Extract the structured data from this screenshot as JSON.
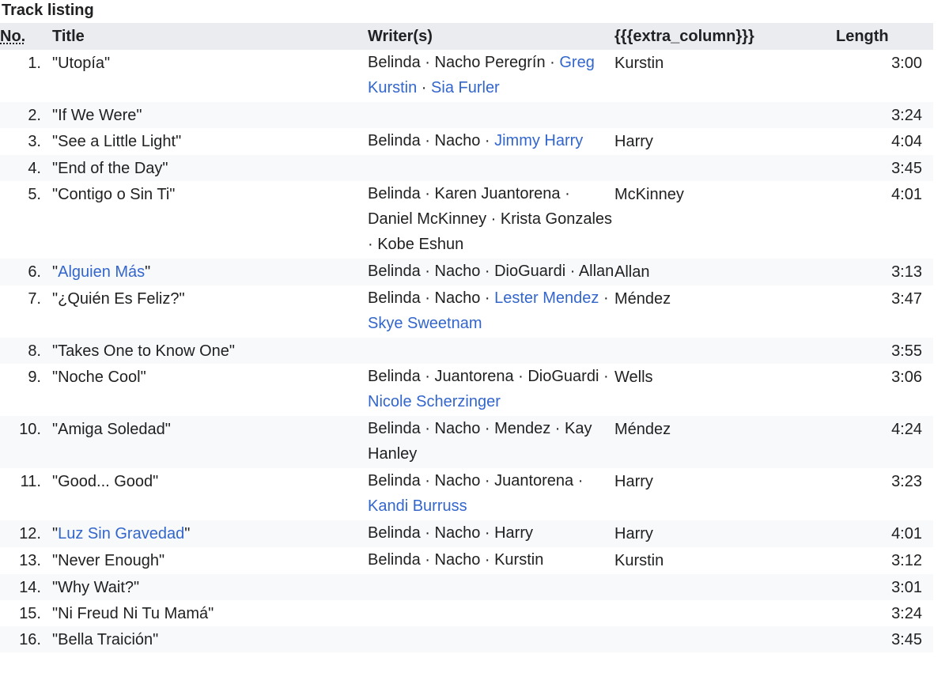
{
  "caption": "Track listing",
  "columns": {
    "no": "No.",
    "title": "Title",
    "writers": "Writer(s)",
    "extra": "{{{extra_column}}}",
    "length": "Length"
  },
  "colors": {
    "link": "#3366cc",
    "header_bg": "#eaecf0",
    "stripe_bg": "#f8f9fa",
    "text": "#202122"
  },
  "tracks": [
    {
      "no": "1.",
      "title": [
        {
          "t": "\"Utopía\""
        }
      ],
      "writers": [
        {
          "t": "Belinda"
        },
        {
          "t": "Nacho Peregrín"
        },
        {
          "t": "Greg Kurstin",
          "link": true
        },
        {
          "t": "Sia Furler",
          "link": true
        }
      ],
      "extra": "Kurstin",
      "length": "3:00"
    },
    {
      "no": "2.",
      "title": [
        {
          "t": "\"If We Were\""
        }
      ],
      "writers": [],
      "extra": "",
      "length": "3:24"
    },
    {
      "no": "3.",
      "title": [
        {
          "t": "\"See a Little Light\""
        }
      ],
      "writers": [
        {
          "t": "Belinda"
        },
        {
          "t": "Nacho"
        },
        {
          "t": "Jimmy Harry",
          "link": true
        }
      ],
      "extra": "Harry",
      "length": "4:04"
    },
    {
      "no": "4.",
      "title": [
        {
          "t": "\"End of the Day\""
        }
      ],
      "writers": [],
      "extra": "",
      "length": "3:45"
    },
    {
      "no": "5.",
      "title": [
        {
          "t": "\"Contigo o Sin Ti\""
        }
      ],
      "writers": [
        {
          "t": "Belinda"
        },
        {
          "t": "Karen Juantorena"
        },
        {
          "t": "Daniel McKinney"
        },
        {
          "t": "Krista Gonzales"
        },
        {
          "t": "Kobe Eshun"
        }
      ],
      "extra": "McKinney",
      "length": "4:01"
    },
    {
      "no": "6.",
      "title": [
        {
          "t": "\""
        },
        {
          "t": "Alguien Más",
          "link": true
        },
        {
          "t": "\""
        }
      ],
      "writers": [
        {
          "t": "Belinda"
        },
        {
          "t": "Nacho"
        },
        {
          "t": "DioGuardi"
        },
        {
          "t": "Allan"
        }
      ],
      "extra": "Allan",
      "length": "3:13"
    },
    {
      "no": "7.",
      "title": [
        {
          "t": "\"¿Quién Es Feliz?\""
        }
      ],
      "writers": [
        {
          "t": "Belinda"
        },
        {
          "t": "Nacho"
        },
        {
          "t": "Lester Mendez",
          "link": true
        },
        {
          "t": "Skye Sweetnam",
          "link": true
        }
      ],
      "extra": "Méndez",
      "length": "3:47"
    },
    {
      "no": "8.",
      "title": [
        {
          "t": "\"Takes One to Know One\""
        }
      ],
      "writers": [],
      "extra": "",
      "length": "3:55"
    },
    {
      "no": "9.",
      "title": [
        {
          "t": "\"Noche Cool\""
        }
      ],
      "writers": [
        {
          "t": "Belinda"
        },
        {
          "t": "Juantorena"
        },
        {
          "t": "DioGuardi"
        },
        {
          "t": "Nicole Scherzinger",
          "link": true
        }
      ],
      "extra": "Wells",
      "length": "3:06"
    },
    {
      "no": "10.",
      "title": [
        {
          "t": "\"Amiga Soledad\""
        }
      ],
      "writers": [
        {
          "t": "Belinda"
        },
        {
          "t": "Nacho"
        },
        {
          "t": "Mendez"
        },
        {
          "t": "Kay Hanley"
        }
      ],
      "extra": "Méndez",
      "length": "4:24"
    },
    {
      "no": "11.",
      "title": [
        {
          "t": "\"Good... Good\""
        }
      ],
      "writers": [
        {
          "t": "Belinda"
        },
        {
          "t": "Nacho"
        },
        {
          "t": "Juantorena"
        },
        {
          "t": "Kandi Burruss",
          "link": true
        }
      ],
      "extra": "Harry",
      "length": "3:23"
    },
    {
      "no": "12.",
      "title": [
        {
          "t": "\""
        },
        {
          "t": "Luz Sin Gravedad",
          "link": true
        },
        {
          "t": "\""
        }
      ],
      "writers": [
        {
          "t": "Belinda"
        },
        {
          "t": "Nacho"
        },
        {
          "t": "Harry"
        }
      ],
      "extra": "Harry",
      "length": "4:01"
    },
    {
      "no": "13.",
      "title": [
        {
          "t": "\"Never Enough\""
        }
      ],
      "writers": [
        {
          "t": "Belinda"
        },
        {
          "t": "Nacho"
        },
        {
          "t": "Kurstin"
        }
      ],
      "extra": "Kurstin",
      "length": "3:12"
    },
    {
      "no": "14.",
      "title": [
        {
          "t": "\"Why Wait?\""
        }
      ],
      "writers": [],
      "extra": "",
      "length": "3:01"
    },
    {
      "no": "15.",
      "title": [
        {
          "t": "\"Ni Freud Ni Tu Mamá\""
        }
      ],
      "writers": [],
      "extra": "",
      "length": "3:24"
    },
    {
      "no": "16.",
      "title": [
        {
          "t": "\"Bella Traición\""
        }
      ],
      "writers": [],
      "extra": "",
      "length": "3:45"
    }
  ]
}
